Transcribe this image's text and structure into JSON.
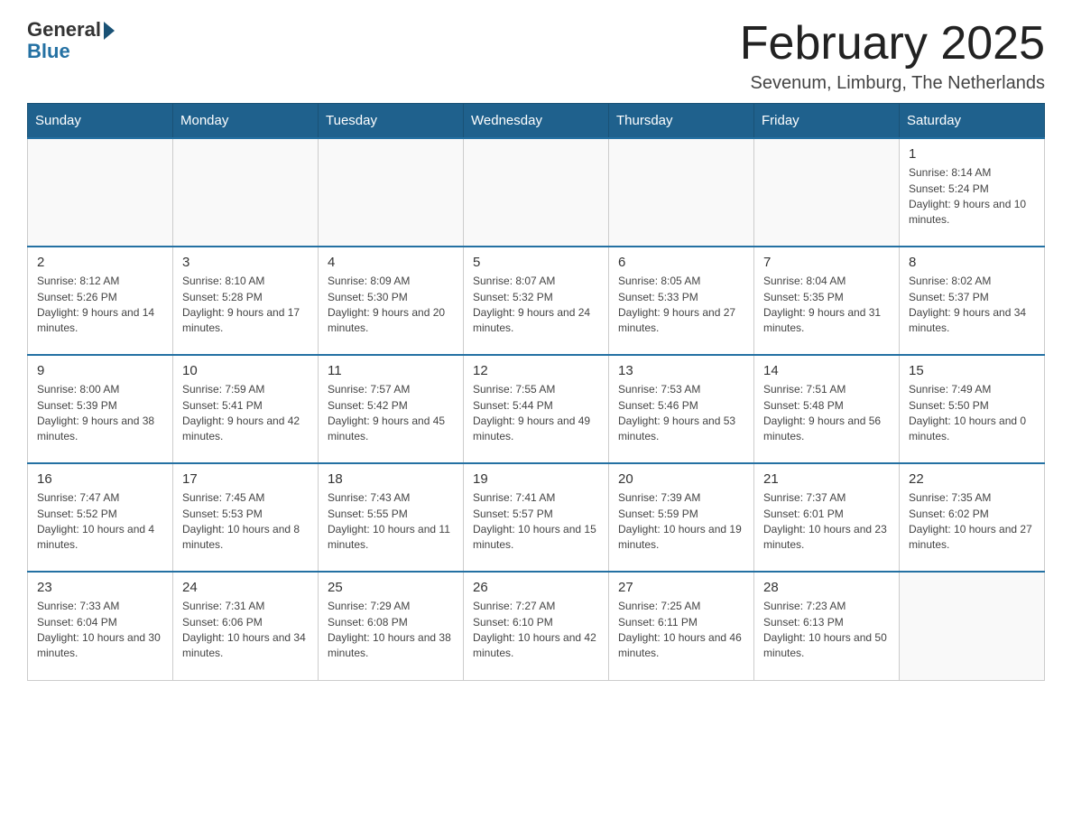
{
  "header": {
    "logo": {
      "general": "General",
      "blue": "Blue"
    },
    "title": "February 2025",
    "subtitle": "Sevenum, Limburg, The Netherlands"
  },
  "weekdays": [
    "Sunday",
    "Monday",
    "Tuesday",
    "Wednesday",
    "Thursday",
    "Friday",
    "Saturday"
  ],
  "weeks": [
    [
      {
        "day": "",
        "info": ""
      },
      {
        "day": "",
        "info": ""
      },
      {
        "day": "",
        "info": ""
      },
      {
        "day": "",
        "info": ""
      },
      {
        "day": "",
        "info": ""
      },
      {
        "day": "",
        "info": ""
      },
      {
        "day": "1",
        "info": "Sunrise: 8:14 AM\nSunset: 5:24 PM\nDaylight: 9 hours and 10 minutes."
      }
    ],
    [
      {
        "day": "2",
        "info": "Sunrise: 8:12 AM\nSunset: 5:26 PM\nDaylight: 9 hours and 14 minutes."
      },
      {
        "day": "3",
        "info": "Sunrise: 8:10 AM\nSunset: 5:28 PM\nDaylight: 9 hours and 17 minutes."
      },
      {
        "day": "4",
        "info": "Sunrise: 8:09 AM\nSunset: 5:30 PM\nDaylight: 9 hours and 20 minutes."
      },
      {
        "day": "5",
        "info": "Sunrise: 8:07 AM\nSunset: 5:32 PM\nDaylight: 9 hours and 24 minutes."
      },
      {
        "day": "6",
        "info": "Sunrise: 8:05 AM\nSunset: 5:33 PM\nDaylight: 9 hours and 27 minutes."
      },
      {
        "day": "7",
        "info": "Sunrise: 8:04 AM\nSunset: 5:35 PM\nDaylight: 9 hours and 31 minutes."
      },
      {
        "day": "8",
        "info": "Sunrise: 8:02 AM\nSunset: 5:37 PM\nDaylight: 9 hours and 34 minutes."
      }
    ],
    [
      {
        "day": "9",
        "info": "Sunrise: 8:00 AM\nSunset: 5:39 PM\nDaylight: 9 hours and 38 minutes."
      },
      {
        "day": "10",
        "info": "Sunrise: 7:59 AM\nSunset: 5:41 PM\nDaylight: 9 hours and 42 minutes."
      },
      {
        "day": "11",
        "info": "Sunrise: 7:57 AM\nSunset: 5:42 PM\nDaylight: 9 hours and 45 minutes."
      },
      {
        "day": "12",
        "info": "Sunrise: 7:55 AM\nSunset: 5:44 PM\nDaylight: 9 hours and 49 minutes."
      },
      {
        "day": "13",
        "info": "Sunrise: 7:53 AM\nSunset: 5:46 PM\nDaylight: 9 hours and 53 minutes."
      },
      {
        "day": "14",
        "info": "Sunrise: 7:51 AM\nSunset: 5:48 PM\nDaylight: 9 hours and 56 minutes."
      },
      {
        "day": "15",
        "info": "Sunrise: 7:49 AM\nSunset: 5:50 PM\nDaylight: 10 hours and 0 minutes."
      }
    ],
    [
      {
        "day": "16",
        "info": "Sunrise: 7:47 AM\nSunset: 5:52 PM\nDaylight: 10 hours and 4 minutes."
      },
      {
        "day": "17",
        "info": "Sunrise: 7:45 AM\nSunset: 5:53 PM\nDaylight: 10 hours and 8 minutes."
      },
      {
        "day": "18",
        "info": "Sunrise: 7:43 AM\nSunset: 5:55 PM\nDaylight: 10 hours and 11 minutes."
      },
      {
        "day": "19",
        "info": "Sunrise: 7:41 AM\nSunset: 5:57 PM\nDaylight: 10 hours and 15 minutes."
      },
      {
        "day": "20",
        "info": "Sunrise: 7:39 AM\nSunset: 5:59 PM\nDaylight: 10 hours and 19 minutes."
      },
      {
        "day": "21",
        "info": "Sunrise: 7:37 AM\nSunset: 6:01 PM\nDaylight: 10 hours and 23 minutes."
      },
      {
        "day": "22",
        "info": "Sunrise: 7:35 AM\nSunset: 6:02 PM\nDaylight: 10 hours and 27 minutes."
      }
    ],
    [
      {
        "day": "23",
        "info": "Sunrise: 7:33 AM\nSunset: 6:04 PM\nDaylight: 10 hours and 30 minutes."
      },
      {
        "day": "24",
        "info": "Sunrise: 7:31 AM\nSunset: 6:06 PM\nDaylight: 10 hours and 34 minutes."
      },
      {
        "day": "25",
        "info": "Sunrise: 7:29 AM\nSunset: 6:08 PM\nDaylight: 10 hours and 38 minutes."
      },
      {
        "day": "26",
        "info": "Sunrise: 7:27 AM\nSunset: 6:10 PM\nDaylight: 10 hours and 42 minutes."
      },
      {
        "day": "27",
        "info": "Sunrise: 7:25 AM\nSunset: 6:11 PM\nDaylight: 10 hours and 46 minutes."
      },
      {
        "day": "28",
        "info": "Sunrise: 7:23 AM\nSunset: 6:13 PM\nDaylight: 10 hours and 50 minutes."
      },
      {
        "day": "",
        "info": ""
      }
    ]
  ]
}
